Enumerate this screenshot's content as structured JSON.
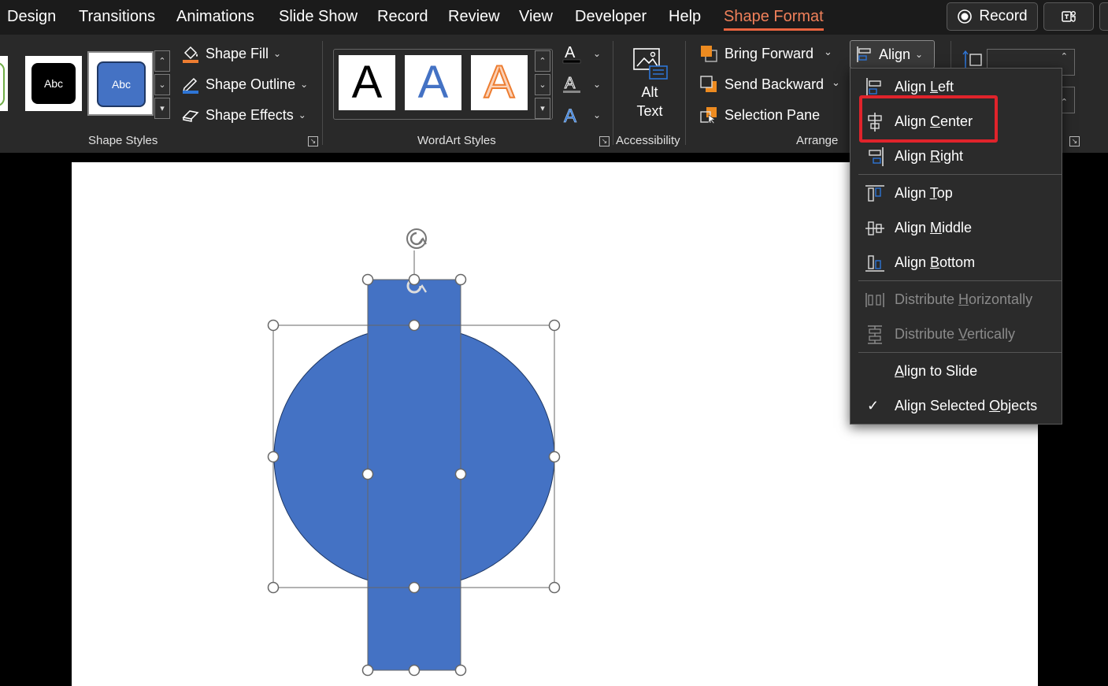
{
  "tabs": {
    "design": "Design",
    "transitions": "Transitions",
    "animations": "Animations",
    "slide_show": "Slide Show",
    "record": "Record",
    "review": "Review",
    "view": "View",
    "developer": "Developer",
    "help": "Help",
    "shape_format": "Shape Format",
    "active": "Shape Format"
  },
  "titlebar_buttons": {
    "record_label": "Record"
  },
  "ribbon": {
    "shape_styles": {
      "label": "Shape Styles",
      "thumb_text": [
        "Abc",
        "Abc"
      ],
      "shape_fill": "Shape Fill",
      "shape_outline": "Shape Outline",
      "shape_effects": "Shape Effects"
    },
    "wordart_styles": {
      "label": "WordArt Styles",
      "letters": [
        "A",
        "A",
        "A"
      ]
    },
    "accessibility": {
      "label": "Accessibility",
      "alt_text_line1": "Alt",
      "alt_text_line2": "Text"
    },
    "arrange": {
      "label": "Arrange",
      "bring_forward": "Bring Forward",
      "send_backward": "Send Backward",
      "selection_pane": "Selection Pane",
      "align": "Align"
    }
  },
  "align_menu": {
    "items": [
      {
        "label": "Align Left",
        "mnemonic": "L",
        "enabled": true
      },
      {
        "label": "Align Center",
        "mnemonic": "C",
        "enabled": true
      },
      {
        "label": "Align Right",
        "mnemonic": "R",
        "enabled": true
      },
      {
        "label": "Align Top",
        "mnemonic": "T",
        "enabled": true
      },
      {
        "label": "Align Middle",
        "mnemonic": "M",
        "enabled": true
      },
      {
        "label": "Align Bottom",
        "mnemonic": "B",
        "enabled": true
      },
      {
        "label": "Distribute Horizontally",
        "mnemonic": "H",
        "enabled": false
      },
      {
        "label": "Distribute Vertically",
        "mnemonic": "V",
        "enabled": false
      },
      {
        "label": "Align to Slide",
        "mnemonic": "A",
        "enabled": true
      },
      {
        "label": "Align Selected Objects",
        "mnemonic": "O",
        "enabled": true,
        "checked": true
      }
    ],
    "highlighted": "Align Center"
  },
  "colors": {
    "accent_tab": "#f0805a",
    "shape_fill": "#4472c4",
    "highlight_box": "#e0232b"
  }
}
